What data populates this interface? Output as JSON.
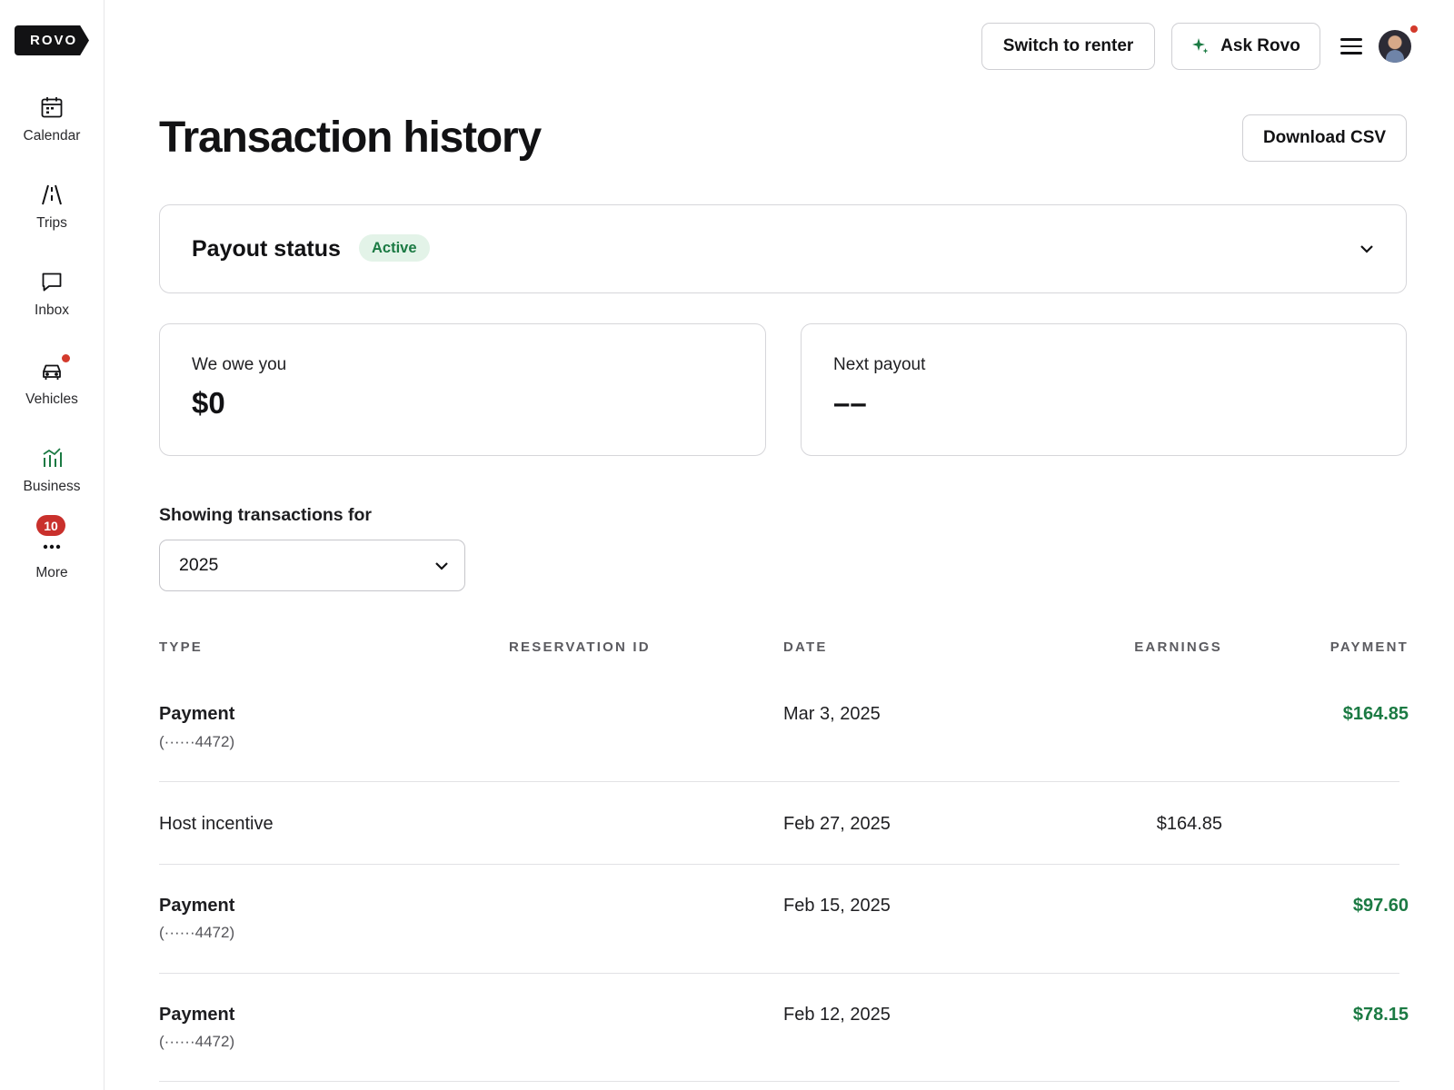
{
  "brand": {
    "logo": "ROVO"
  },
  "sidebar": {
    "items": [
      {
        "label": "Calendar",
        "icon": "calendar-icon"
      },
      {
        "label": "Trips",
        "icon": "road-icon"
      },
      {
        "label": "Inbox",
        "icon": "chat-icon"
      },
      {
        "label": "Vehicles",
        "icon": "car-icon"
      },
      {
        "label": "Business",
        "icon": "chart-icon"
      },
      {
        "label": "More",
        "icon": "more-icon",
        "badge": "10"
      }
    ]
  },
  "header": {
    "switch_label": "Switch to renter",
    "ask_label": "Ask Rovo",
    "download_label": "Download CSV"
  },
  "page": {
    "title": "Transaction history"
  },
  "payout": {
    "title": "Payout status",
    "status": "Active"
  },
  "summary": {
    "owe_label": "We owe you",
    "owe_value": "$0",
    "next_label": "Next payout",
    "next_value": "––"
  },
  "filter": {
    "label": "Showing transactions for",
    "year": "2025"
  },
  "table": {
    "headers": [
      "TYPE",
      "RESERVATION ID",
      "DATE",
      "EARNINGS",
      "PAYMENT"
    ],
    "rows": [
      {
        "type": "Payment",
        "sub": "(······4472)",
        "date": "Mar 3, 2025",
        "earnings": "",
        "payment": "$164.85"
      },
      {
        "type": "Host incentive",
        "sub": "",
        "date": "Feb 27, 2025",
        "earnings": "$164.85",
        "payment": ""
      },
      {
        "type": "Payment",
        "sub": "(······4472)",
        "date": "Feb 15, 2025",
        "earnings": "",
        "payment": "$97.60"
      },
      {
        "type": "Payment",
        "sub": "(······4472)",
        "date": "Feb 12, 2025",
        "earnings": "",
        "payment": "$78.15"
      }
    ]
  },
  "colors": {
    "accent_green": "#1b7a43",
    "badge_red": "#c9302c",
    "dark": "#121214"
  }
}
